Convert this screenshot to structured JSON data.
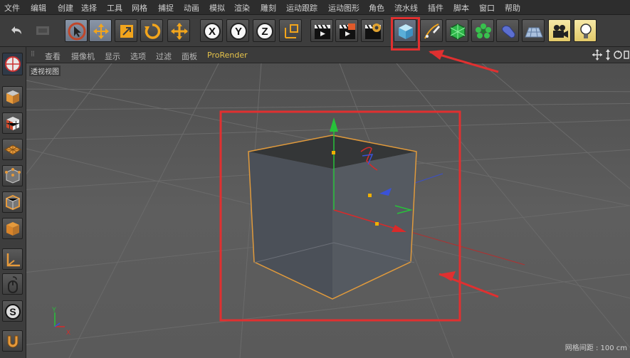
{
  "menu": [
    "文件",
    "编辑",
    "创建",
    "选择",
    "工具",
    "网格",
    "捕捉",
    "动画",
    "模拟",
    "渲染",
    "雕刻",
    "运动跟踪",
    "运动图形",
    "角色",
    "流水线",
    "插件",
    "脚本",
    "窗口",
    "帮助"
  ],
  "toolbar": {
    "buttons": [
      "undo-icon",
      "redo-icon",
      "select-arrow-icon",
      "move-icon",
      "scale-icon",
      "rotate-icon",
      "transform-icon",
      "x-axis-icon",
      "y-axis-icon",
      "z-axis-icon",
      "coordinate-system-icon",
      "render-view-icon",
      "render-picture-viewer-icon",
      "render-settings-icon",
      "cube-primitive-icon",
      "pen-spline-icon",
      "subdivision-icon",
      "array-cloner-icon",
      "deformer-icon",
      "floor-icon",
      "camera-icon",
      "light-icon"
    ],
    "axis_labels": [
      "X",
      "Y",
      "Z"
    ],
    "highlighted": "cube-primitive-icon"
  },
  "sidebar": {
    "buttons": [
      "make-editable-icon",
      "model-mode-icon",
      "texture-mode-icon",
      "workplane-icon",
      "points-mode-icon",
      "edges-mode-icon",
      "polygons-mode-icon",
      "axis-mode-icon",
      "tweak-mouse-icon",
      "snap-s-icon",
      "magnet-icon"
    ],
    "snap_letter": "S"
  },
  "viewport_menu": [
    "查看",
    "摄像机",
    "显示",
    "选项",
    "过滤",
    "面板",
    "ProRender"
  ],
  "viewport": {
    "label": "透视视图",
    "grid_spacing": "网格间距 : 100 cm",
    "axis_letters": [
      "Y",
      "X"
    ]
  },
  "colors": {
    "annotation": "#e03030",
    "object_outline": "#e09a3c",
    "y_axis": "#27c23a",
    "x_axis": "#d92a2a",
    "z_axis": "#3a52d8",
    "prorender": "#e6c34a"
  }
}
